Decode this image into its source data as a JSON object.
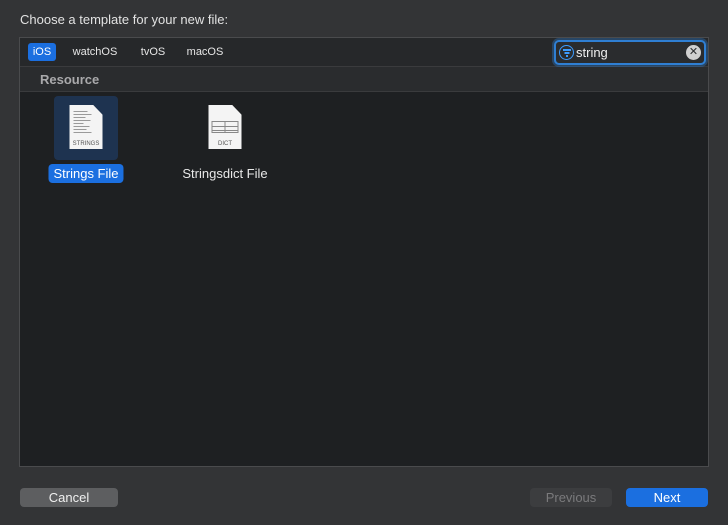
{
  "dialog": {
    "title": "Choose a template for your new file:"
  },
  "platform_tabs": [
    {
      "label": "iOS",
      "selected": true
    },
    {
      "label": "watchOS",
      "selected": false
    },
    {
      "label": "tvOS",
      "selected": false
    },
    {
      "label": "macOS",
      "selected": false
    }
  ],
  "search": {
    "value": "string",
    "filter_icon": "filter-icon",
    "clear_icon": "clear-icon"
  },
  "section": {
    "title": "Resource"
  },
  "templates": [
    {
      "label": "Strings File",
      "icon_caption": "STRINGS",
      "selected": true
    },
    {
      "label": "Stringsdict File",
      "icon_caption": "DICT",
      "selected": false
    }
  ],
  "buttons": {
    "cancel": "Cancel",
    "previous": "Previous",
    "next": "Next"
  },
  "colors": {
    "accent": "#1b6fe0",
    "background": "#333436",
    "panel": "#1e2022"
  }
}
